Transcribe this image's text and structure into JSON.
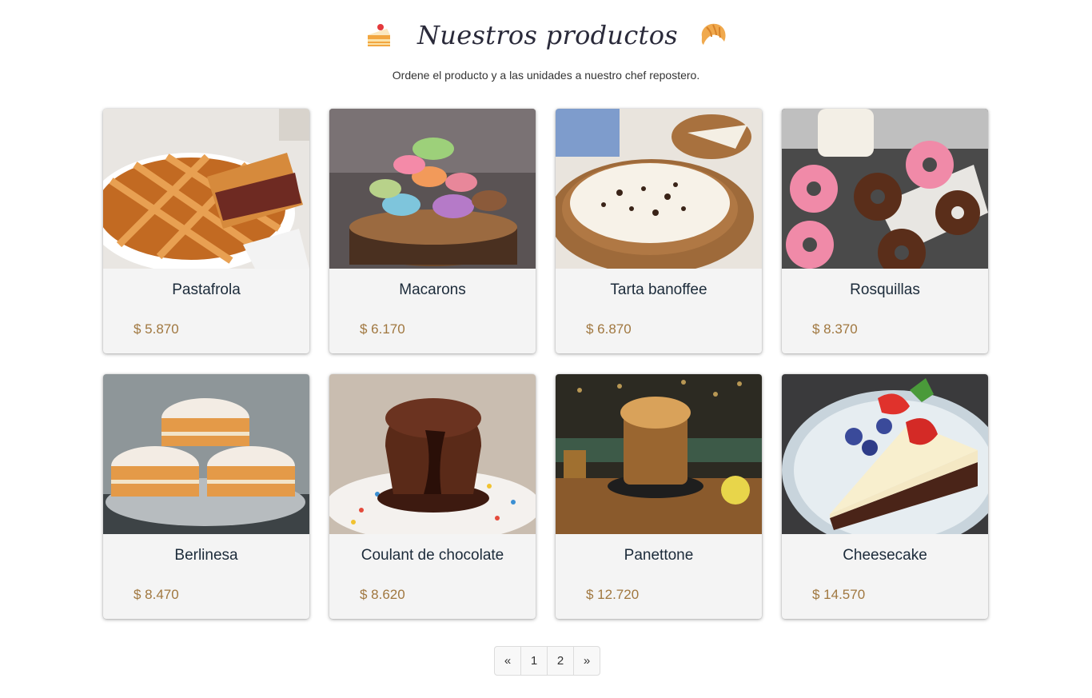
{
  "header": {
    "title": "Nuestros productos",
    "subtitle": "Ordene el producto y a las unidades a nuestro chef repostero."
  },
  "products": [
    {
      "name": "Pastafrola",
      "price": "$ 5.870"
    },
    {
      "name": "Macarons",
      "price": "$ 6.170"
    },
    {
      "name": "Tarta banoffee",
      "price": "$ 6.870"
    },
    {
      "name": "Rosquillas",
      "price": "$ 8.370"
    },
    {
      "name": "Berlinesa",
      "price": "$ 8.470"
    },
    {
      "name": "Coulant de chocolate",
      "price": "$ 8.620"
    },
    {
      "name": "Panettone",
      "price": "$ 12.720"
    },
    {
      "name": "Cheesecake",
      "price": "$ 14.570"
    }
  ],
  "pagination": {
    "prev": "«",
    "pages": [
      "1",
      "2"
    ],
    "next": "»"
  },
  "colors": {
    "price": "#a0773f",
    "name": "#1c2b3a",
    "card_bg": "#f4f4f4"
  }
}
